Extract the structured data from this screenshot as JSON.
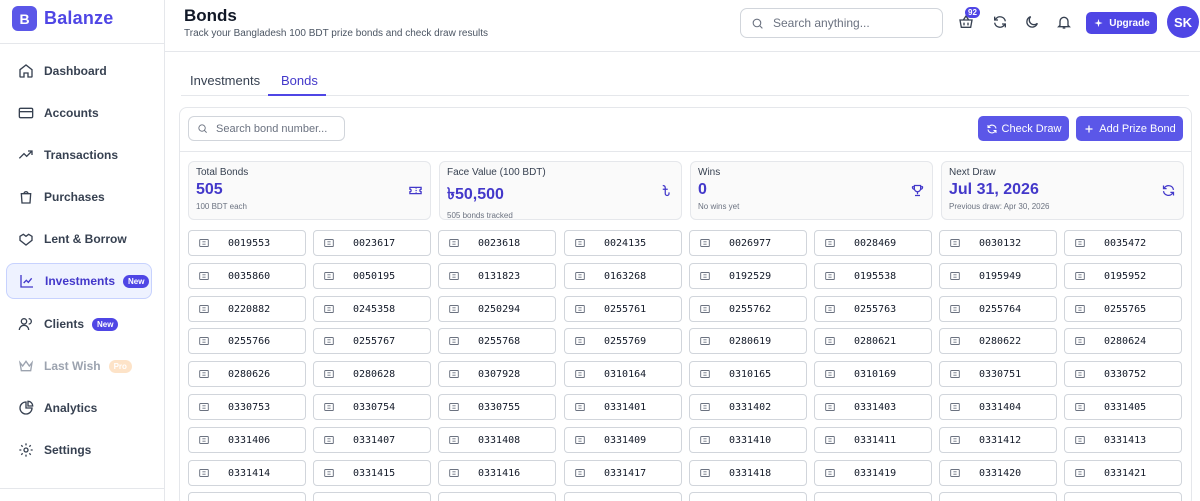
{
  "brand": {
    "logo_letter": "B",
    "name": "Balanze"
  },
  "sidebar": {
    "items": [
      {
        "label": "Dashboard",
        "icon": "home-icon"
      },
      {
        "label": "Accounts",
        "icon": "credit-card-icon"
      },
      {
        "label": "Transactions",
        "icon": "trending-up-icon"
      },
      {
        "label": "Purchases",
        "icon": "shopping-bag-icon"
      },
      {
        "label": "Lent & Borrow",
        "icon": "handshake-icon"
      },
      {
        "label": "Investments",
        "icon": "chart-line-icon",
        "badge": "New",
        "active": true
      },
      {
        "label": "Clients",
        "icon": "users-icon",
        "badge": "New"
      },
      {
        "label": "Last Wish",
        "icon": "crown-icon",
        "badge": "Pro",
        "muted": true
      },
      {
        "label": "Analytics",
        "icon": "pie-chart-icon"
      },
      {
        "label": "Settings",
        "icon": "gear-icon"
      }
    ]
  },
  "header": {
    "title": "Bonds",
    "subtitle": "Track your Bangladesh 100 BDT prize bonds and check draw results",
    "search_placeholder": "Search anything...",
    "notification_count": "92",
    "upgrade_label": "Upgrade",
    "avatar_initials": "SK"
  },
  "tabs": [
    {
      "label": "Investments"
    },
    {
      "label": "Bonds",
      "active": true
    }
  ],
  "bonds": {
    "search_placeholder": "Search bond number...",
    "check_draw_label": "Check Draw",
    "add_label": "Add Prize Bond",
    "stats": [
      {
        "label": "Total Bonds",
        "value": "505",
        "sub": "100 BDT each",
        "icon": "ticket-icon"
      },
      {
        "label": "Face Value (100 BDT)",
        "value": "৳50,500",
        "sub": "505 bonds tracked",
        "icon": "taka-icon"
      },
      {
        "label": "Wins",
        "value": "0",
        "sub": "No wins yet",
        "icon": "trophy-icon"
      },
      {
        "label": "Next Draw",
        "value": "Jul 31, 2026",
        "sub": "Previous draw: Apr 30, 2026",
        "icon": "refresh-icon"
      }
    ],
    "numbers": [
      "0019553",
      "0023617",
      "0023618",
      "0024135",
      "0026977",
      "0028469",
      "0030132",
      "0035472",
      "0035860",
      "0050195",
      "0131823",
      "0163268",
      "0192529",
      "0195538",
      "0195949",
      "0195952",
      "0220882",
      "0245358",
      "0250294",
      "0255761",
      "0255762",
      "0255763",
      "0255764",
      "0255765",
      "0255766",
      "0255767",
      "0255768",
      "0255769",
      "0280619",
      "0280621",
      "0280622",
      "0280624",
      "0280626",
      "0280628",
      "0307928",
      "0310164",
      "0310165",
      "0310169",
      "0330751",
      "0330752",
      "0330753",
      "0330754",
      "0330755",
      "0331401",
      "0331402",
      "0331403",
      "0331404",
      "0331405",
      "0331406",
      "0331407",
      "0331408",
      "0331409",
      "0331410",
      "0331411",
      "0331412",
      "0331413",
      "0331414",
      "0331415",
      "0331416",
      "0331417",
      "0331418",
      "0331419",
      "0331420",
      "0331421"
    ]
  },
  "colors": {
    "accent": "#4f46e5",
    "active_bg": "#eef2ff",
    "border": "#e5e7eb"
  }
}
